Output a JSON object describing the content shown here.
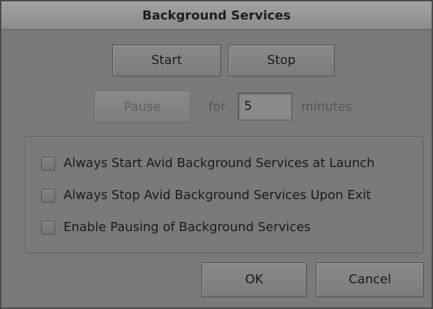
{
  "dialog": {
    "title": "Background Services"
  },
  "controls": {
    "start_label": "Start",
    "stop_label": "Stop",
    "pause_label": "Pause",
    "for_label": "for",
    "minutes_value": "5",
    "minutes_label": "minutes"
  },
  "options": [
    {
      "label": "Always Start Avid Background Services at Launch",
      "checked": false
    },
    {
      "label": "Always Stop Avid Background Services Upon Exit",
      "checked": false
    },
    {
      "label": "Enable Pausing of Background Services",
      "checked": false
    }
  ],
  "footer": {
    "ok_label": "OK",
    "cancel_label": "Cancel"
  }
}
